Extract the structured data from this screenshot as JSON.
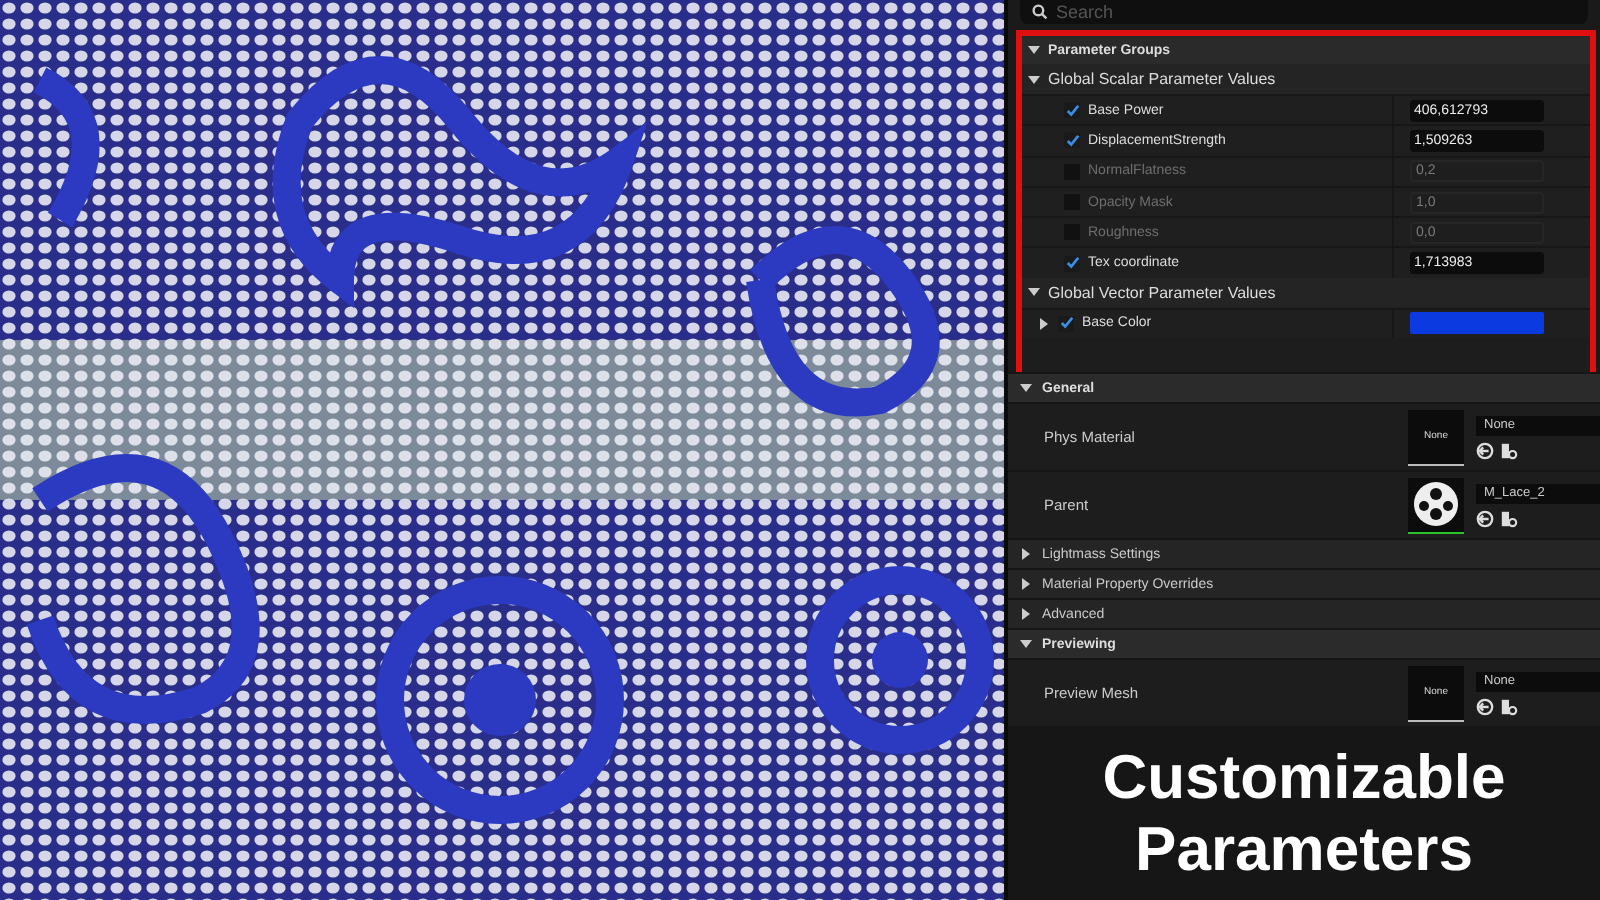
{
  "details": {
    "search": {
      "placeholder": "Search"
    },
    "parameter_groups": {
      "title": "Parameter Groups",
      "expanded": true,
      "highlighted": true,
      "groups": [
        {
          "title": "Global Scalar Parameter Values",
          "expanded": true,
          "params": [
            {
              "kind": "scalar",
              "name": "Base Power",
              "checked": true,
              "value": "406,612793"
            },
            {
              "kind": "scalar",
              "name": "DisplacementStrength",
              "checked": true,
              "value": "1,509263"
            },
            {
              "kind": "scalar",
              "name": "NormalFlatness",
              "checked": false,
              "value": "0,2"
            },
            {
              "kind": "scalar",
              "name": "Opacity Mask",
              "checked": false,
              "value": "1,0"
            },
            {
              "kind": "scalar",
              "name": "Roughness",
              "checked": false,
              "value": "0,0"
            },
            {
              "kind": "scalar",
              "name": "Tex coordinate",
              "checked": true,
              "value": "1,713983"
            }
          ]
        },
        {
          "title": "Global Vector Parameter Values",
          "expanded": true,
          "params": [
            {
              "kind": "vector",
              "name": "Base Color",
              "checked": true,
              "expanded": false,
              "color": "#0a3ae0"
            }
          ]
        }
      ]
    },
    "sections": [
      {
        "title": "General",
        "expanded": true,
        "rows": [
          {
            "label": "Phys Material",
            "thumbnail": {
              "kind": "empty",
              "label": "None"
            },
            "value": "None"
          },
          {
            "label": "Parent",
            "thumbnail": {
              "kind": "material"
            },
            "value": "M_Lace_2"
          }
        ]
      },
      {
        "title": "Lightmass Settings",
        "expanded": false
      },
      {
        "title": "Material Property Overrides",
        "expanded": false
      },
      {
        "title": "Advanced",
        "expanded": false
      },
      {
        "title": "Previewing",
        "expanded": true,
        "rows": [
          {
            "label": "Preview Mesh",
            "thumbnail": {
              "kind": "empty",
              "label": "None"
            },
            "value": "None"
          }
        ]
      }
    ]
  },
  "caption": {
    "text": "Customizable Parameters"
  }
}
